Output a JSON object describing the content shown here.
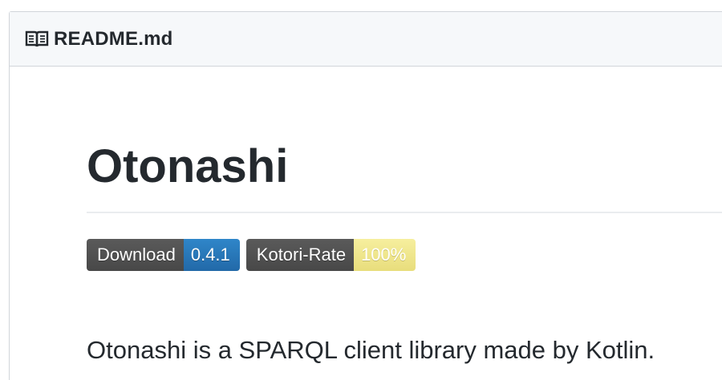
{
  "file_header": {
    "icon": "book-icon",
    "file_name": "README.md"
  },
  "readme": {
    "title": "Otonashi",
    "badges": [
      {
        "label": "Download",
        "value": "0.4.1",
        "value_color": "#2a77b8"
      },
      {
        "label": "Kotori-Rate",
        "value": "100%",
        "value_color": "#efe58c"
      }
    ],
    "description": "Otonashi is a SPARQL client library made by Kotlin."
  }
}
